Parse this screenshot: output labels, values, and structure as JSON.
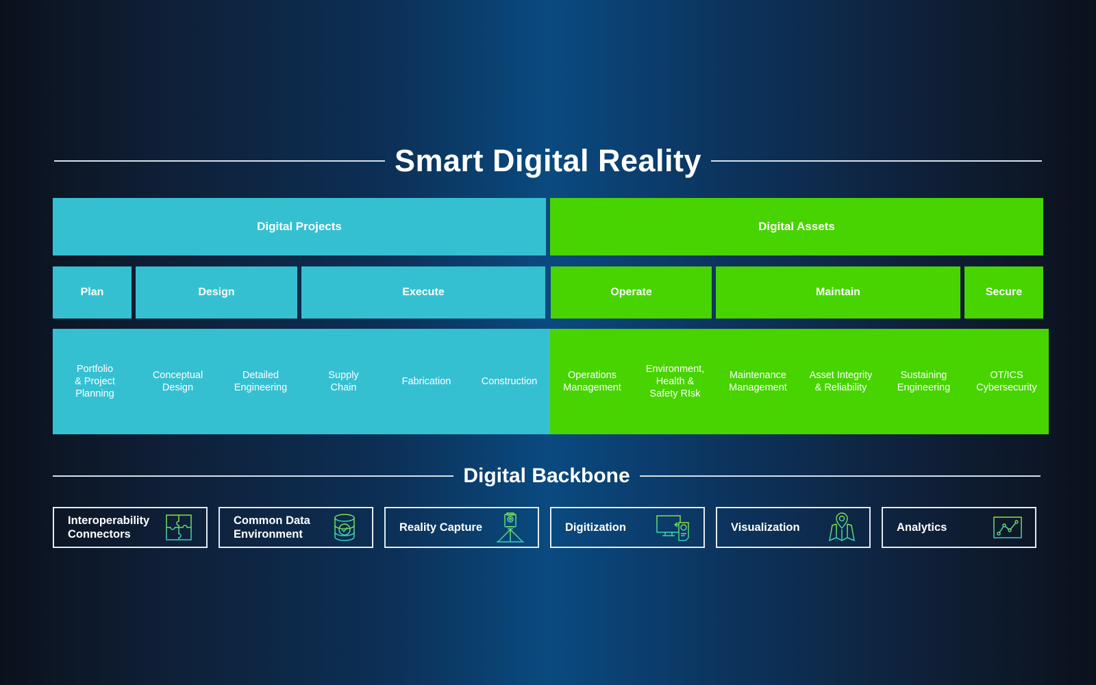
{
  "title": "Smart Digital Reality",
  "colors": {
    "projects": "#35c0d2",
    "assets": "#47d400",
    "icon_gradient": [
      "#8be33a",
      "#35d1c0"
    ]
  },
  "bands": [
    {
      "label": "Digital Projects",
      "color": "blue"
    },
    {
      "label": "Digital Assets",
      "color": "green"
    }
  ],
  "phases": [
    {
      "label": "Plan"
    },
    {
      "label": "Design"
    },
    {
      "label": "Execute"
    },
    {
      "label": "Operate"
    },
    {
      "label": "Maintain"
    },
    {
      "label": "Secure"
    }
  ],
  "items": [
    {
      "label": "Portfolio\n& Project\nPlanning"
    },
    {
      "label": "Conceptual\nDesign"
    },
    {
      "label": "Detailed\nEngineering"
    },
    {
      "label": "Supply\nChain"
    },
    {
      "label": "Fabrication"
    },
    {
      "label": "Construction"
    },
    {
      "label": "Operations\nManagement"
    },
    {
      "label": "Environment,\nHealth &\nSafety RIsk"
    },
    {
      "label": "Maintenance\nManagement"
    },
    {
      "label": "Asset Integrity\n& Reliability"
    },
    {
      "label": "Sustaining\nEngineering"
    },
    {
      "label": "OT/ICS\nCybersecurity"
    }
  ],
  "backbone": {
    "title": "Digital Backbone",
    "items": [
      {
        "label": "Interoperability\nConnectors",
        "icon": "puzzle-icon"
      },
      {
        "label": "Common Data\nEnvironment",
        "icon": "database-check-icon"
      },
      {
        "label": "Reality Capture",
        "icon": "laser-scanner-tripod-icon"
      },
      {
        "label": "Digitization",
        "icon": "monitor-document-icon"
      },
      {
        "label": "Visualization",
        "icon": "map-pin-icon"
      },
      {
        "label": "Analytics",
        "icon": "line-chart-icon"
      }
    ]
  }
}
